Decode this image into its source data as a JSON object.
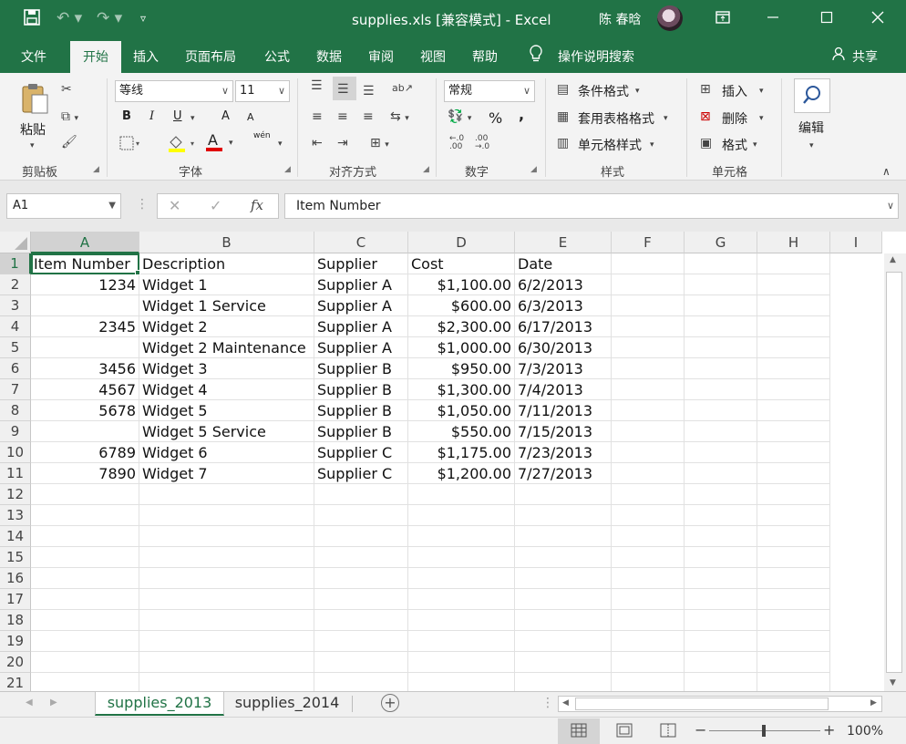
{
  "title": "supplies.xls  [兼容模式]  -  Excel",
  "user": "陈 春晗",
  "window_controls": {
    "restore": "⧉",
    "minimize": "—",
    "maximize": "☐",
    "close": "✕"
  },
  "menu": {
    "file": "文件",
    "home": "开始",
    "insert": "插入",
    "layout": "页面布局",
    "formulas": "公式",
    "data": "数据",
    "review": "审阅",
    "view": "视图",
    "help": "帮助",
    "tellme": "操作说明搜索",
    "share": "共享"
  },
  "ribbon": {
    "clipboard": {
      "paste": "粘贴",
      "label": "剪贴板"
    },
    "font": {
      "name": "等线",
      "size": "11",
      "bold": "B",
      "italic": "I",
      "underline": "U",
      "grow": "A",
      "shrink": "A",
      "fontcolor": "A",
      "phonetic": "wén",
      "label": "字体"
    },
    "alignment": {
      "label": "对齐方式"
    },
    "number": {
      "format": "常规",
      "percent": "%",
      "comma": ",",
      "label": "数字"
    },
    "styles": {
      "conditional": "条件格式",
      "table": "套用表格格式",
      "cell": "单元格样式",
      "label": "样式"
    },
    "cells": {
      "insert": "插入",
      "delete": "删除",
      "format": "格式",
      "label": "单元格"
    },
    "editing": {
      "label": "编辑"
    }
  },
  "formula_bar": {
    "namebox": "A1",
    "cancel": "✕",
    "enter": "✓",
    "fx": "fx",
    "content": "Item Number"
  },
  "columns": [
    "A",
    "B",
    "C",
    "D",
    "E",
    "F",
    "G",
    "H",
    "I"
  ],
  "rows": [
    "1",
    "2",
    "3",
    "4",
    "5",
    "6",
    "7",
    "8",
    "9",
    "10",
    "11",
    "12",
    "13",
    "14",
    "15",
    "16",
    "17",
    "18",
    "19",
    "20",
    "21"
  ],
  "table": {
    "headers": [
      "Item Number",
      "Description",
      "Supplier",
      "Cost",
      "Date"
    ],
    "rows": [
      [
        "1234",
        "Widget 1",
        "Supplier A",
        "$1,100.00",
        "6/2/2013"
      ],
      [
        "",
        "Widget 1 Service",
        "Supplier A",
        "$600.00",
        "6/3/2013"
      ],
      [
        "2345",
        "Widget 2",
        "Supplier A",
        "$2,300.00",
        "6/17/2013"
      ],
      [
        "",
        "Widget 2 Maintenance",
        "Supplier A",
        "$1,000.00",
        "6/30/2013"
      ],
      [
        "3456",
        "Widget 3",
        "Supplier B",
        "$950.00",
        "7/3/2013"
      ],
      [
        "4567",
        "Widget 4",
        "Supplier B",
        "$1,300.00",
        "7/4/2013"
      ],
      [
        "5678",
        "Widget 5",
        "Supplier B",
        "$1,050.00",
        "7/11/2013"
      ],
      [
        "",
        "Widget 5 Service",
        "Supplier B",
        "$550.00",
        "7/15/2013"
      ],
      [
        "6789",
        "Widget 6",
        "Supplier C",
        "$1,175.00",
        "7/23/2013"
      ],
      [
        "7890",
        "Widget 7",
        "Supplier C",
        "$1,200.00",
        "7/27/2013"
      ]
    ]
  },
  "sheets": {
    "active": "supplies_2013",
    "other": "supplies_2014",
    "add": "+"
  },
  "status": {
    "zoom": "100%",
    "zoom_minus": "−",
    "zoom_plus": "+"
  },
  "colors": {
    "accent": "#217346"
  }
}
